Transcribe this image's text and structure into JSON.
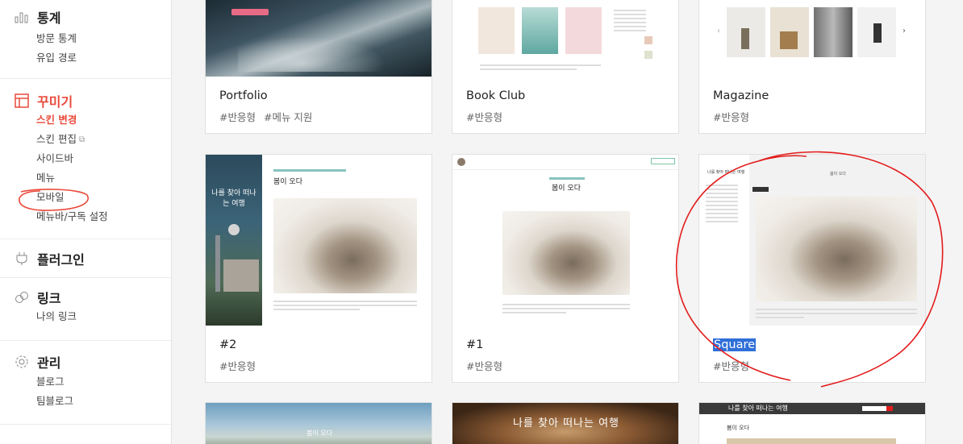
{
  "sidebar": {
    "sections": [
      {
        "title": "통계",
        "items": [
          "방문 통계",
          "유입 경로"
        ]
      },
      {
        "title": "꾸미기",
        "items": [
          "스킨 변경",
          "스킨 편집",
          "사이드바",
          "메뉴",
          "모바일",
          "메뉴바/구독 설정"
        ]
      },
      {
        "title": "플러그인",
        "items": []
      },
      {
        "title": "링크",
        "items": [
          "나의 링크"
        ]
      },
      {
        "title": "관리",
        "items": [
          "블로그",
          "팀블로그"
        ]
      }
    ],
    "current_item": "스킨 변경"
  },
  "skins": [
    {
      "name": "Portfolio",
      "tags": [
        "#반응형",
        "#메뉴 지원"
      ]
    },
    {
      "name": "Book Club",
      "tags": [
        "#반응형"
      ]
    },
    {
      "name": "Magazine",
      "tags": [
        "#반응형"
      ]
    },
    {
      "name": "#2",
      "tags": [
        "#반응형"
      ]
    },
    {
      "name": "#1",
      "tags": [
        "#반응형"
      ]
    },
    {
      "name": "Square",
      "tags": [
        "#반응형"
      ]
    }
  ],
  "previews": {
    "travel_title": "나를 찾아 떠나는 여행",
    "post_title": "봄이 오다",
    "bottom_spring": "봄이 오다",
    "bottom_travel": "나를 찾아 떠나는 여행",
    "bottom_travel_2": "나를 찾아 떠나는 여행",
    "bottom_post": "봄이 오다"
  },
  "colors": {
    "accent": "#e94a3b",
    "selection": "#2f6fd8"
  }
}
